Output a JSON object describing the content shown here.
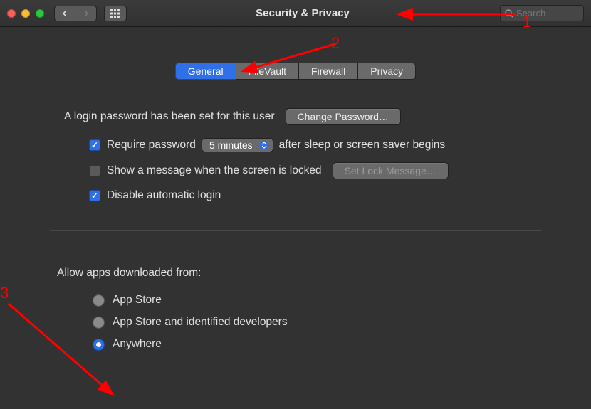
{
  "window": {
    "title": "Security & Privacy",
    "search_placeholder": "Search"
  },
  "tabs": [
    {
      "label": "General",
      "active": true
    },
    {
      "label": "FileVault",
      "active": false
    },
    {
      "label": "Firewall",
      "active": false
    },
    {
      "label": "Privacy",
      "active": false
    }
  ],
  "login": {
    "status_text": "A login password has been set for this user",
    "change_password_btn": "Change Password…",
    "require_password": {
      "checked": true,
      "pre_text": "Require password",
      "dropdown_value": "5 minutes",
      "post_text": "after sleep or screen saver begins"
    },
    "show_message": {
      "checked": false,
      "label": "Show a message when the screen is locked",
      "set_btn": "Set Lock Message…"
    },
    "disable_auto_login": {
      "checked": true,
      "label": "Disable automatic login"
    }
  },
  "downloads": {
    "section_label": "Allow apps downloaded from:",
    "options": [
      {
        "label": "App Store",
        "selected": false
      },
      {
        "label": "App Store and identified developers",
        "selected": false
      },
      {
        "label": "Anywhere",
        "selected": true
      }
    ]
  },
  "annotations": {
    "a1": "1",
    "a2": "2",
    "a3": "3"
  }
}
